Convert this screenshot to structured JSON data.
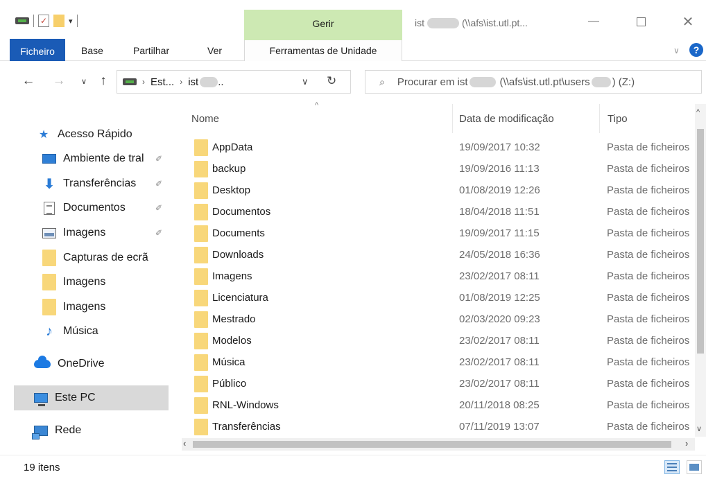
{
  "window": {
    "title_prefix": "ist",
    "title_suffix": "(\\\\afs\\ist.utl.pt...",
    "context_tab_group": "Gerir"
  },
  "ribbon": {
    "tabs": [
      {
        "label": "Ficheiro",
        "active": true
      },
      {
        "label": "Base"
      },
      {
        "label": "Partilhar"
      },
      {
        "label": "Ver"
      },
      {
        "label": "Ferramentas de Unidade"
      }
    ]
  },
  "navigation": {
    "back_icon": "arrow-left-icon",
    "forward_icon": "arrow-right-icon",
    "recent_icon": "chevron-down-icon",
    "up_icon": "arrow-up-icon",
    "address_segments": [
      "Est...",
      "ist"
    ],
    "address_trail": "..",
    "search_prefix": "Procurar em ist",
    "search_suffix": "(\\\\afs\\ist.utl.pt\\users",
    "search_drive": ") (Z:)"
  },
  "sidebar": {
    "items": [
      {
        "label": "Acesso Rápido",
        "icon": "star-icon"
      },
      {
        "label": "Ambiente de tral",
        "icon": "desktop-icon",
        "pinned": true
      },
      {
        "label": "Transferências",
        "icon": "download-icon",
        "pinned": true
      },
      {
        "label": "Documentos",
        "icon": "document-icon",
        "pinned": true
      },
      {
        "label": "Imagens",
        "icon": "pictures-icon",
        "pinned": true
      },
      {
        "label": "Capturas de ecrã",
        "icon": "folder-icon"
      },
      {
        "label": "Imagens",
        "icon": "folder-icon"
      },
      {
        "label": "Imagens",
        "icon": "folder-icon"
      },
      {
        "label": "Música",
        "icon": "music-note-icon"
      },
      {
        "label": "OneDrive",
        "icon": "cloud-icon"
      },
      {
        "label": "Este PC",
        "icon": "computer-icon",
        "selected": true
      },
      {
        "label": "Rede",
        "icon": "network-icon"
      }
    ]
  },
  "columns": {
    "name": "Nome",
    "date": "Data de modificação",
    "type": "Tipo"
  },
  "files": [
    {
      "name": "AppData",
      "date": "19/09/2017 10:32",
      "type": "Pasta de ficheiros"
    },
    {
      "name": "backup",
      "date": "19/09/2016 11:13",
      "type": "Pasta de ficheiros"
    },
    {
      "name": "Desktop",
      "date": "01/08/2019 12:26",
      "type": "Pasta de ficheiros"
    },
    {
      "name": "Documentos",
      "date": "18/04/2018 11:51",
      "type": "Pasta de ficheiros"
    },
    {
      "name": "Documents",
      "date": "19/09/2017 11:15",
      "type": "Pasta de ficheiros"
    },
    {
      "name": "Downloads",
      "date": "24/05/2018 16:36",
      "type": "Pasta de ficheiros"
    },
    {
      "name": "Imagens",
      "date": "23/02/2017 08:11",
      "type": "Pasta de ficheiros"
    },
    {
      "name": "Licenciatura",
      "date": "01/08/2019 12:25",
      "type": "Pasta de ficheiros"
    },
    {
      "name": "Mestrado",
      "date": "02/03/2020 09:23",
      "type": "Pasta de ficheiros"
    },
    {
      "name": "Modelos",
      "date": "23/02/2017 08:11",
      "type": "Pasta de ficheiros"
    },
    {
      "name": "Música",
      "date": "23/02/2017 08:11",
      "type": "Pasta de ficheiros"
    },
    {
      "name": "Público",
      "date": "23/02/2017 08:11",
      "type": "Pasta de ficheiros"
    },
    {
      "name": "RNL-Windows",
      "date": "20/11/2018 08:25",
      "type": "Pasta de ficheiros"
    },
    {
      "name": "Transferências",
      "date": "07/11/2019 13:07",
      "type": "Pasta de ficheiros"
    }
  ],
  "status": {
    "item_count": "19 itens"
  },
  "colors": {
    "file_tab": "#1a5bb6",
    "gerir_band": "#cde9b3",
    "folder": "#f7cf6b",
    "selected_nav": "#d9d9d9"
  }
}
